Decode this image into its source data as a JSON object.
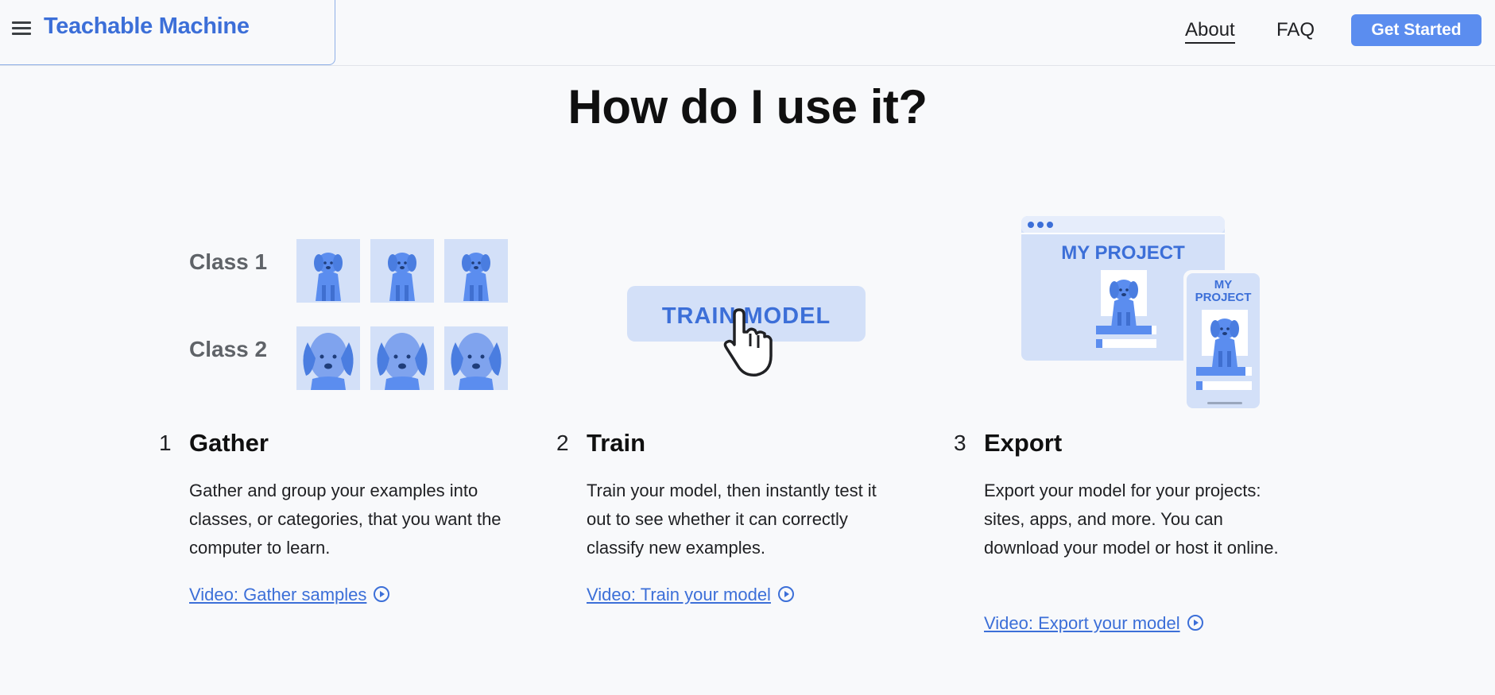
{
  "header": {
    "brand": "Teachable Machine",
    "nav": {
      "about": "About",
      "faq": "FAQ"
    },
    "cta": "Get Started"
  },
  "section": {
    "heading": "How do I use it?"
  },
  "illustrations": {
    "gather": {
      "class1": "Class 1",
      "class2": "Class 2"
    },
    "train": {
      "button_label": "TRAIN MODEL"
    },
    "export": {
      "desktop_title": "MY PROJECT",
      "mobile_title_line1": "MY",
      "mobile_title_line2": "PROJECT"
    }
  },
  "steps": [
    {
      "number": "1",
      "title": "Gather",
      "description": "Gather and group your examples into classes, or categories, that you want the computer to learn.",
      "link": "Video: Gather samples"
    },
    {
      "number": "2",
      "title": "Train",
      "description": "Train your model, then instantly test it out to see whether it can correctly classify new examples.",
      "link": "Video: Train your model"
    },
    {
      "number": "3",
      "title": "Export",
      "description": "Export your model for your projects: sites, apps, and more. You can download your model or host it online.",
      "link": "Video: Export your model"
    }
  ],
  "colors": {
    "brand_blue": "#3c6fd8",
    "cta_blue": "#5b8def",
    "light_blue": "#d3e0f8",
    "mid_blue": "#5b8def",
    "background": "#f8f9fb"
  }
}
